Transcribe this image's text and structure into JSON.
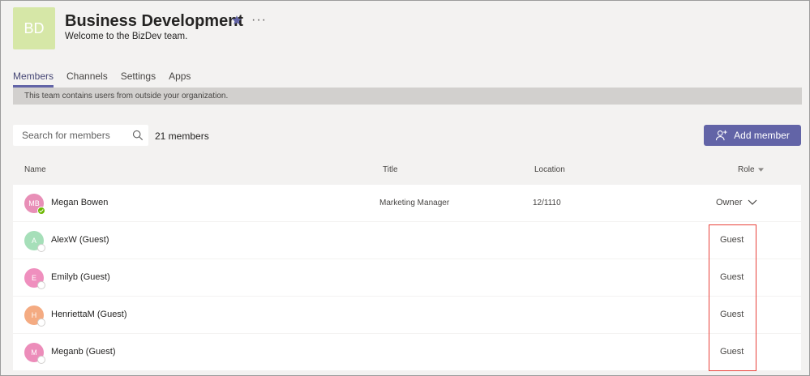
{
  "team": {
    "initials": "BD",
    "name": "Business Development",
    "description": "Welcome to the BizDev team.",
    "more": "···"
  },
  "tabs": [
    {
      "label": "Members",
      "active": true
    },
    {
      "label": "Channels",
      "active": false
    },
    {
      "label": "Settings",
      "active": false
    },
    {
      "label": "Apps",
      "active": false
    }
  ],
  "banner": "This team contains users from outside your organization.",
  "search": {
    "placeholder": "Search for members",
    "value": ""
  },
  "member_count": "21 members",
  "add_member_label": "Add member",
  "columns": {
    "name": "Name",
    "title": "Title",
    "location": "Location",
    "role": "Role"
  },
  "members": [
    {
      "initials": "MB",
      "name": "Megan Bowen",
      "title": "Marketing Manager",
      "location": "12/1110",
      "role": "Owner",
      "avatar_color": "#e88fb7",
      "presence": "available"
    },
    {
      "initials": "A",
      "name": "AlexW (Guest)",
      "title": "",
      "location": "",
      "role": "Guest",
      "avatar_color": "#a6dfb9",
      "presence": "offline"
    },
    {
      "initials": "E",
      "name": "Emilyb (Guest)",
      "title": "",
      "location": "",
      "role": "Guest",
      "avatar_color": "#ef8fbe",
      "presence": "offline"
    },
    {
      "initials": "H",
      "name": "HenriettaM (Guest)",
      "title": "",
      "location": "",
      "role": "Guest",
      "avatar_color": "#f4ab82",
      "presence": "offline"
    },
    {
      "initials": "M",
      "name": "Meganb (Guest)",
      "title": "",
      "location": "",
      "role": "Guest",
      "avatar_color": "#ec8dba",
      "presence": "offline"
    }
  ],
  "colors": {
    "accent": "#6264a7",
    "highlight": "#e8413a",
    "team_avatar": "#d6e7a7"
  }
}
